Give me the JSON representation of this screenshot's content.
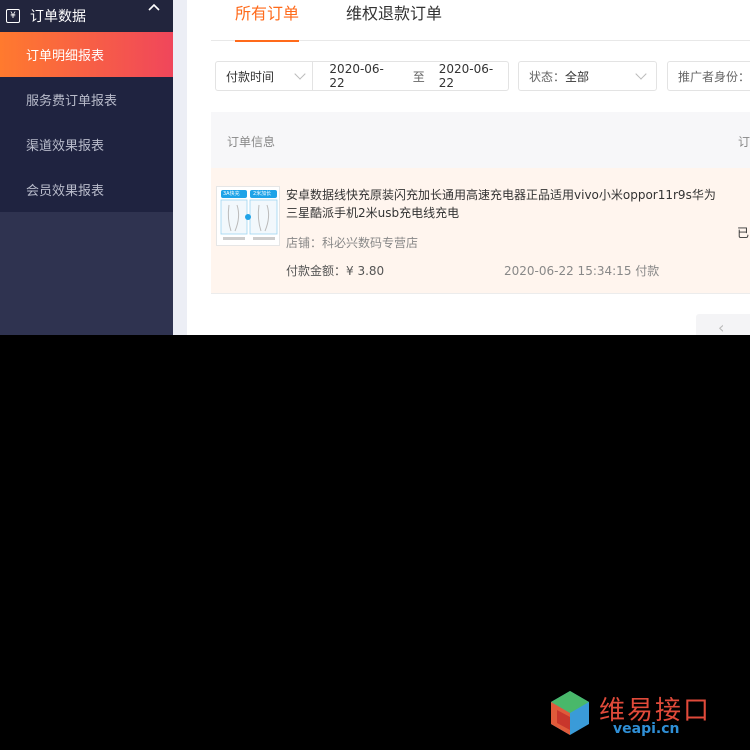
{
  "sidebar": {
    "group_label": "订单数据",
    "items": [
      {
        "label": "订单明细报表",
        "active": true
      },
      {
        "label": "服务费订单报表",
        "active": false
      },
      {
        "label": "渠道效果报表",
        "active": false
      },
      {
        "label": "会员效果报表",
        "active": false
      }
    ]
  },
  "tabs": [
    {
      "label": "所有订单",
      "active": true
    },
    {
      "label": "维权退款订单",
      "active": false
    }
  ],
  "filters": {
    "time_type": "付款时间",
    "date_from": "2020-06-22",
    "date_sep": "至",
    "date_to": "2020-06-22",
    "status_label": "状态：",
    "status_value": "全部",
    "promoter_label": "推广者身份："
  },
  "table": {
    "headers": [
      "订单信息",
      "订"
    ]
  },
  "order": {
    "thumb_tags": [
      "3A快充",
      "2米加长"
    ],
    "title": "安卓数据线快充原装闪充加长通用高速充电器正品适用vivo小米oppor11r9s华为三星酷派手机2米usb充电线充电",
    "shop": "店铺：科必兴数码专营店",
    "amount_label": "付款金额：",
    "amount": "¥ 3.80",
    "paid_time": "2020-06-22 15:34:15 付款",
    "status_partial": "已"
  },
  "pager": {
    "prev_glyph": "‹"
  },
  "watermark": {
    "brand": "维易接口",
    "domain": "veapi.cn"
  },
  "colors": {
    "accent": "#ff6a1a",
    "sidebar_bg": "#2b2e4a",
    "active_gradient_start": "#ff7a2e",
    "active_gradient_end": "#f0465b",
    "brand_red": "#e04a3a",
    "brand_blue": "#2f8fd6"
  }
}
